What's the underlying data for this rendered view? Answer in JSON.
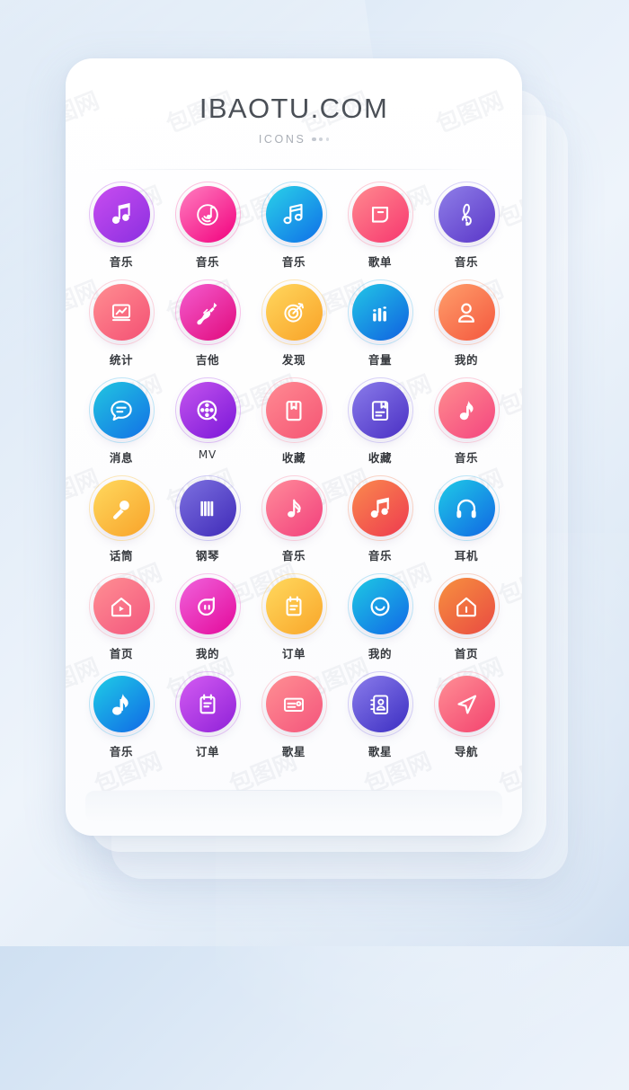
{
  "header": {
    "brand": "IBAOTU.COM",
    "subtitle": "ICONS"
  },
  "watermark": {
    "text": "包图网"
  },
  "icons": [
    {
      "label": "音乐",
      "icon": "beamed-note-icon",
      "c1": "#c84df0",
      "c2": "#8b2fe0",
      "ring": "#c77df0"
    },
    {
      "label": "音乐",
      "icon": "vinyl-note-icon",
      "c1": "#ff7fc0",
      "c2": "#f2007e",
      "ring": "#fb76b8"
    },
    {
      "label": "音乐",
      "icon": "beamed-note-outline-icon",
      "c1": "#2ad2e8",
      "c2": "#0f6fe8",
      "ring": "#6fc6f2"
    },
    {
      "label": "歌单",
      "icon": "playlist-card-icon",
      "c1": "#ff8a8f",
      "c2": "#f7376f",
      "ring": "#fd93ab"
    },
    {
      "label": "音乐",
      "icon": "treble-clef-icon",
      "c1": "#8f7fe8",
      "c2": "#5a36c8",
      "ring": "#a79af0"
    },
    {
      "label": "统计",
      "icon": "chart-board-icon",
      "c1": "#ff8e91",
      "c2": "#f45074",
      "ring": "#fb9fb4"
    },
    {
      "label": "吉他",
      "icon": "guitar-icon",
      "c1": "#f45ccf",
      "c2": "#e10a7c",
      "ring": "#f57fd0"
    },
    {
      "label": "发现",
      "icon": "compass-icon",
      "c1": "#ffd75e",
      "c2": "#f9a227",
      "ring": "#fcc95f"
    },
    {
      "label": "音量",
      "icon": "bar-levels-icon",
      "c1": "#22c6e6",
      "c2": "#1060e0",
      "ring": "#74c9f0"
    },
    {
      "label": "我的",
      "icon": "user-icon",
      "c1": "#ff9f6b",
      "c2": "#f4573e",
      "ring": "#fba98a"
    },
    {
      "label": "消息",
      "icon": "chat-bubble-icon",
      "c1": "#22c6e0",
      "c2": "#1270e6",
      "ring": "#6fc9ef"
    },
    {
      "label": "MV",
      "icon": "film-reel-icon",
      "c1": "#c455ee",
      "c2": "#7a16d8",
      "ring": "#c27ef0"
    },
    {
      "label": "收藏",
      "icon": "bookmark-page-icon",
      "c1": "#ff8a92",
      "c2": "#f55574",
      "ring": "#fca3b3"
    },
    {
      "label": "收藏",
      "icon": "book-mark-icon",
      "c1": "#8a7cea",
      "c2": "#4a2fc4",
      "ring": "#a89cf0"
    },
    {
      "label": "音乐",
      "icon": "single-note-icon",
      "c1": "#ff8d8f",
      "c2": "#f4457f",
      "ring": "#fb9cb6"
    },
    {
      "label": "话筒",
      "icon": "microphone-icon",
      "c1": "#ffd95e",
      "c2": "#f8a32a",
      "ring": "#fbcb62"
    },
    {
      "label": "钢琴",
      "icon": "piano-keys-icon",
      "c1": "#7d71e0",
      "c2": "#3f2ab8",
      "ring": "#9b92ec"
    },
    {
      "label": "音乐",
      "icon": "eighth-note-icon",
      "c1": "#ff8c9a",
      "c2": "#f23f7c",
      "ring": "#fb9cb4"
    },
    {
      "label": "音乐",
      "icon": "beamed-note-solid-icon",
      "c1": "#fa8a4e",
      "c2": "#ee3a4f",
      "ring": "#f79f7e"
    },
    {
      "label": "耳机",
      "icon": "headphones-icon",
      "c1": "#1fcbe6",
      "c2": "#1166e4",
      "ring": "#6ec9f0"
    },
    {
      "label": "首页",
      "icon": "home-play-icon",
      "c1": "#ff8f93",
      "c2": "#f3567e",
      "ring": "#fba3b2"
    },
    {
      "label": "我的",
      "icon": "smiley-face-icon",
      "c1": "#f063dd",
      "c2": "#e4099a",
      "ring": "#f287d6"
    },
    {
      "label": "订单",
      "icon": "clipboard-icon",
      "c1": "#ffd95e",
      "c2": "#f9a62a",
      "ring": "#fbcb62"
    },
    {
      "label": "我的",
      "icon": "smile-circle-icon",
      "c1": "#1ec9e4",
      "c2": "#1168e6",
      "ring": "#6ec9f0"
    },
    {
      "label": "首页",
      "icon": "home-icon",
      "c1": "#f7913f",
      "c2": "#e94a42",
      "ring": "#f4a584"
    },
    {
      "label": "音乐",
      "icon": "note-solid-icon",
      "c1": "#1fcde6",
      "c2": "#1068e6",
      "ring": "#6fcaf0"
    },
    {
      "label": "订单",
      "icon": "clipboard-lines-icon",
      "c1": "#d45cf2",
      "c2": "#8f21d8",
      "ring": "#cb87ee"
    },
    {
      "label": "歌星",
      "icon": "id-card-icon",
      "c1": "#ff8f93",
      "c2": "#f4557c",
      "ring": "#fba4b3"
    },
    {
      "label": "歌星",
      "icon": "contact-book-icon",
      "c1": "#8a7ceb",
      "c2": "#3c2ec2",
      "ring": "#a79bf0"
    },
    {
      "label": "导航",
      "icon": "navigation-arrow-icon",
      "c1": "#ff8f95",
      "c2": "#f3436f",
      "ring": "#fb9fb2"
    }
  ]
}
